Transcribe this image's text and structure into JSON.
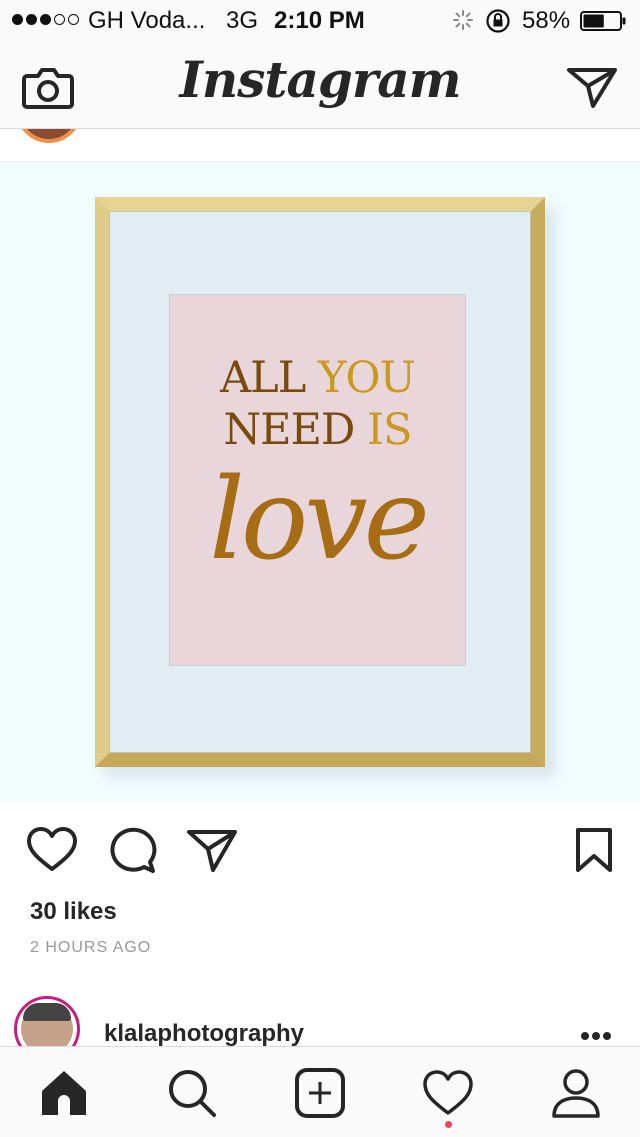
{
  "status_bar": {
    "carrier": "GH Voda...",
    "network": "3G",
    "time": "2:10 PM",
    "battery_percent": "58%",
    "battery_level": 0.58,
    "signal_bars": 3,
    "signal_total": 5
  },
  "header": {
    "logo": "Instagram",
    "left_icon": "camera-icon",
    "right_icon": "direct-message-icon"
  },
  "post": {
    "artwork": {
      "line1_part1": "ALL ",
      "line1_part2": "YOU",
      "line2_part1": "NEED ",
      "line2_part2": "IS",
      "script": "love"
    },
    "actions": [
      "heart-icon",
      "comment-icon",
      "share-icon",
      "bookmark-icon"
    ],
    "likes": "30 likes",
    "timestamp": "2 HOURS AGO"
  },
  "next_post": {
    "username": "klalaphotography",
    "more_icon": "more-icon"
  },
  "tab_bar": {
    "items": [
      "home-icon",
      "search-icon",
      "add-post-icon",
      "activity-heart-icon",
      "profile-icon"
    ],
    "active": "home-icon",
    "notification_color": "#ed4956"
  },
  "colors": {
    "text": "#262626",
    "secondary_text": "#999999",
    "bar_background": "#fafafa",
    "story_ring": "#c21e83"
  }
}
